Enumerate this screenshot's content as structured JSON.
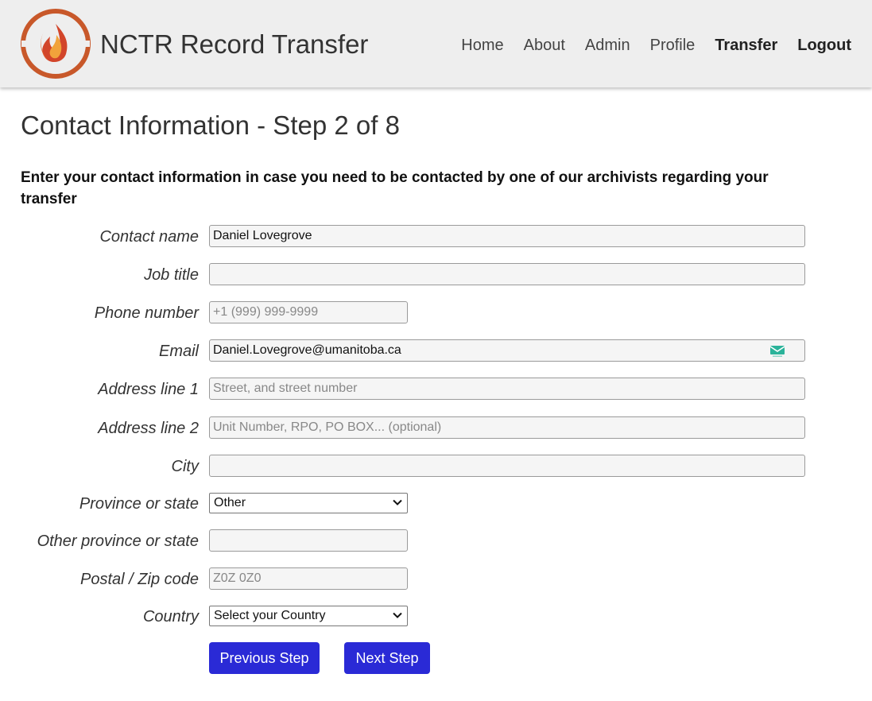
{
  "header": {
    "site_title": "NCTR Record Transfer",
    "nav": [
      "Home",
      "About",
      "Admin",
      "Profile",
      "Transfer",
      "Logout"
    ],
    "logo_colors": {
      "ring": "#c8582a",
      "flame_outer": "#d2452a",
      "flame_inner": "#f1a33b"
    }
  },
  "page": {
    "title": "Contact Information - Step 2 of 8",
    "instructions": "Enter your contact information in case you need to be contacted by one of our archivists regarding your transfer"
  },
  "form": {
    "contact_name": {
      "label": "Contact name",
      "value": "Daniel Lovegrove",
      "placeholder": ""
    },
    "job_title": {
      "label": "Job title",
      "value": "",
      "placeholder": ""
    },
    "phone_number": {
      "label": "Phone number",
      "value": "",
      "placeholder": "+1 (999) 999-9999"
    },
    "email": {
      "label": "Email",
      "value": "Daniel.Lovegrove@umanitoba.ca",
      "placeholder": ""
    },
    "address_line_1": {
      "label": "Address line 1",
      "value": "",
      "placeholder": "Street, and street number"
    },
    "address_line_2": {
      "label": "Address line 2",
      "value": "",
      "placeholder": "Unit Number, RPO, PO BOX... (optional)"
    },
    "city": {
      "label": "City",
      "value": "",
      "placeholder": ""
    },
    "province_or_state": {
      "label": "Province or state",
      "selected": "Other"
    },
    "other_province_or_state": {
      "label": "Other province or state",
      "value": "",
      "placeholder": ""
    },
    "postal_code": {
      "label": "Postal / Zip code",
      "value": "",
      "placeholder": "Z0Z 0Z0"
    },
    "country": {
      "label": "Country",
      "selected": "Select your Country"
    }
  },
  "buttons": {
    "previous": "Previous Step",
    "next": "Next Step"
  },
  "colors": {
    "button_bg": "#2a2ad6",
    "header_bg": "#eeeeee",
    "email_icon": "#2bb39a"
  },
  "icons": {
    "logo": "flame-logo-icon",
    "email_helper": "mail-icon",
    "select_chevron": "chevron-down-icon"
  }
}
